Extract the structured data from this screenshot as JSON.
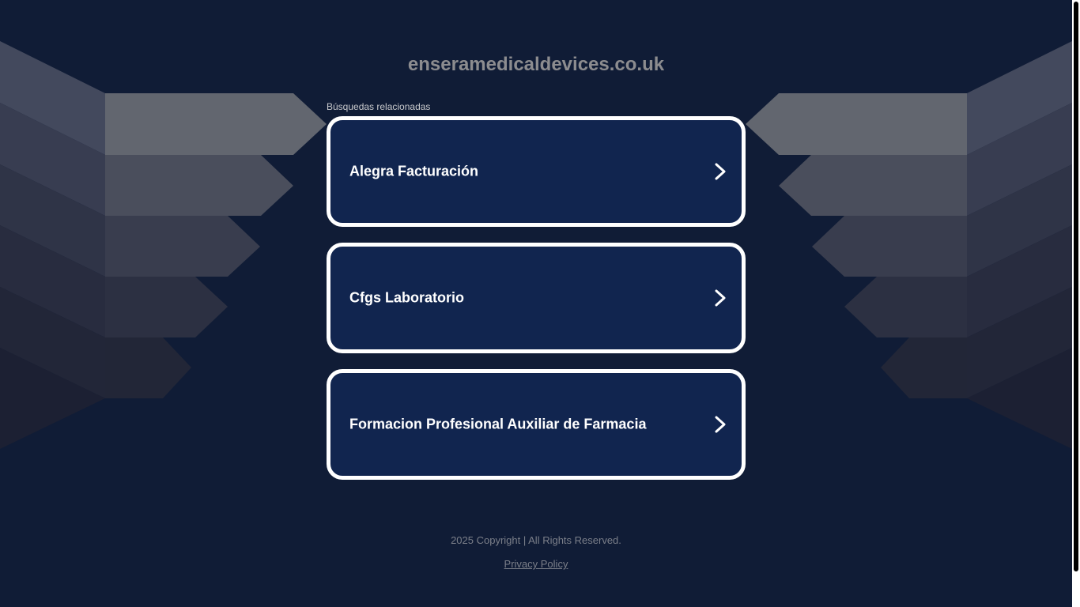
{
  "page": {
    "title": "enseramedicaldevices.co.uk",
    "related_label": "Búsquedas relacionadas"
  },
  "links": [
    {
      "label": "Alegra Facturación"
    },
    {
      "label": "Cfgs Laboratorio"
    },
    {
      "label": "Formacion Profesional Auxiliar de Farmacia"
    }
  ],
  "footer": {
    "copyright": "2025 Copyright | All Rights Reserved.",
    "privacy": "Privacy Policy"
  },
  "colors": {
    "background": "#101c36",
    "card_background": "#11254f",
    "card_border": "#ffffff",
    "title": "#8c8c8f",
    "footer_text": "#7b7f89"
  },
  "icons": {
    "link_arrow": "chevron-right-icon"
  }
}
